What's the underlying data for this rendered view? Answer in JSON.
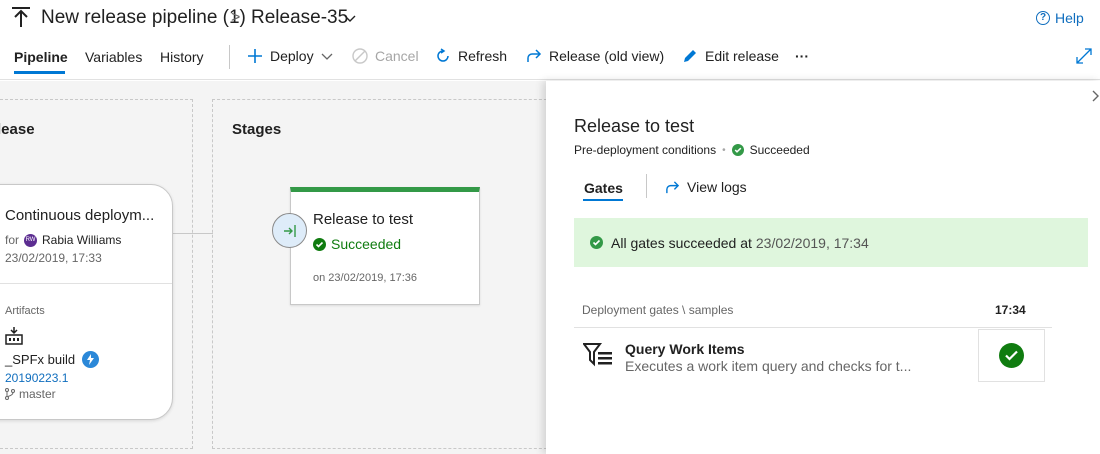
{
  "header": {
    "pipeline_title": "New release pipeline (1)",
    "separator": ">",
    "release_name": "Release-35",
    "help_label": "Help"
  },
  "toolbar": {
    "tabs": [
      {
        "label": "Pipeline",
        "active": true
      },
      {
        "label": "Variables",
        "active": false
      },
      {
        "label": "History",
        "active": false
      }
    ],
    "deploy_label": "Deploy",
    "cancel_label": "Cancel",
    "refresh_label": "Refresh",
    "old_view_label": "Release (old view)",
    "edit_label": "Edit release",
    "more_label": "···"
  },
  "canvas": {
    "release_lane_title": "lease",
    "stages_lane_title": "Stages",
    "artifact_card": {
      "title": "Continuous deploym...",
      "for_label": "for",
      "user": "Rabia Williams",
      "user_initials": "RW",
      "date": "23/02/2019, 17:33",
      "artifacts_label": "Artifacts",
      "build_name": "_SPFx build",
      "build_version": "20190223.1",
      "branch": "master"
    },
    "stage_card": {
      "name": "Release to test",
      "status": "Succeeded",
      "date": "on 23/02/2019, 17:36"
    }
  },
  "panel": {
    "title": "Release to test",
    "subtitle": "Pre-deployment conditions",
    "dot": "•",
    "status": "Succeeded",
    "tab_gates": "Gates",
    "tab_logs": "View logs",
    "banner_text": "All gates succeeded at",
    "banner_time": "23/02/2019, 17:34",
    "gates_header": "Deployment gates \\ samples",
    "gates_time": "17:34",
    "gate": {
      "name": "Query Work Items",
      "description": "Executes a work item query and checks for t..."
    }
  },
  "colors": {
    "accent": "#0078d4",
    "success": "#107c10",
    "stage_bar": "#339947",
    "banner_bg": "#dff6dd"
  }
}
